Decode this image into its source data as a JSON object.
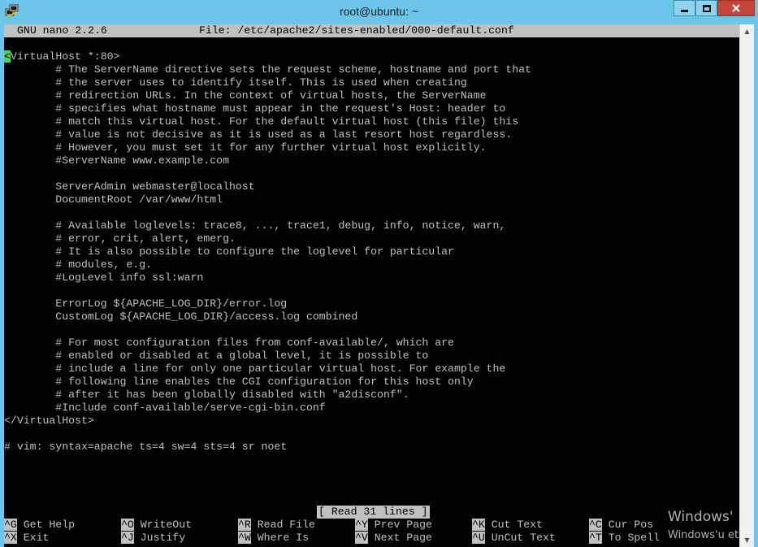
{
  "window": {
    "title": "root@ubuntu: ~",
    "icon": "putty-icon",
    "colors": {
      "titlebar": "#6cc6ea",
      "close": "#c7443a"
    }
  },
  "nano": {
    "version": "GNU nano 2.2.6",
    "file_label": "File: /etc/apache2/sites-enabled/000-default.conf",
    "cursor_char": "<",
    "lines": [
      "",
      "VirtualHost *:80>",
      "        # The ServerName directive sets the request scheme, hostname and port that",
      "        # the server uses to identify itself. This is used when creating",
      "        # redirection URLs. In the context of virtual hosts, the ServerName",
      "        # specifies what hostname must appear in the request's Host: header to",
      "        # match this virtual host. For the default virtual host (this file) this",
      "        # value is not decisive as it is used as a last resort host regardless.",
      "        # However, you must set it for any further virtual host explicitly.",
      "        #ServerName www.example.com",
      "",
      "        ServerAdmin webmaster@localhost",
      "        DocumentRoot /var/www/html",
      "",
      "        # Available loglevels: trace8, ..., trace1, debug, info, notice, warn,",
      "        # error, crit, alert, emerg.",
      "        # It is also possible to configure the loglevel for particular",
      "        # modules, e.g.",
      "        #LogLevel info ssl:warn",
      "",
      "        ErrorLog ${APACHE_LOG_DIR}/error.log",
      "        CustomLog ${APACHE_LOG_DIR}/access.log combined",
      "",
      "        # For most configuration files from conf-available/, which are",
      "        # enabled or disabled at a global level, it is possible to",
      "        # include a line for only one particular virtual host. For example the",
      "        # following line enables the CGI configuration for this host only",
      "        # after it has been globally disabled with \"a2disconf\".",
      "        #Include conf-available/serve-cgi-bin.conf",
      "</VirtualHost>",
      "",
      "# vim: syntax=apache ts=4 sw=4 sts=4 sr noet"
    ],
    "status": "[ Read 31 lines ]",
    "shortcuts_row1": [
      {
        "key": "^G",
        "label": " Get Help"
      },
      {
        "key": "^O",
        "label": " WriteOut"
      },
      {
        "key": "^R",
        "label": " Read File"
      },
      {
        "key": "^Y",
        "label": " Prev Page"
      },
      {
        "key": "^K",
        "label": " Cut Text"
      },
      {
        "key": "^C",
        "label": " Cur Pos"
      }
    ],
    "shortcuts_row2": [
      {
        "key": "^X",
        "label": " Exit"
      },
      {
        "key": "^J",
        "label": " Justify"
      },
      {
        "key": "^W",
        "label": " Where Is"
      },
      {
        "key": "^V",
        "label": " Next Page"
      },
      {
        "key": "^U",
        "label": " UnCut Text"
      },
      {
        "key": "^T",
        "label": " To Spell"
      }
    ],
    "colors": {
      "background": "#000000",
      "text": "#c0c0c0",
      "cursor": "#4cd64c",
      "bar": "#c0c0c0"
    }
  },
  "watermark": {
    "line1": "Windows'",
    "line2": "Windows'u et"
  }
}
